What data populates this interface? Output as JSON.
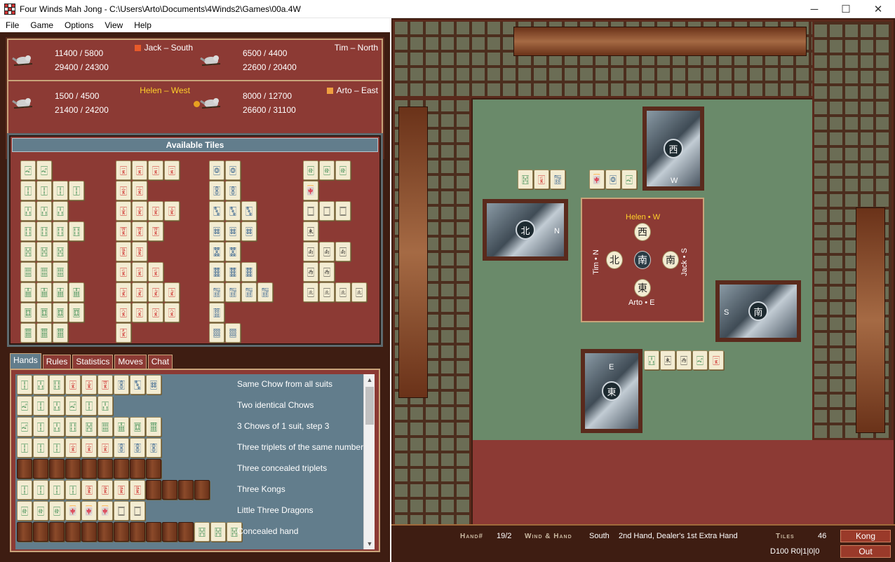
{
  "window": {
    "title": "Four Winds Mah Jong - C:\\Users\\Arto\\Documents\\4Winds2\\Games\\00a.4W",
    "minimize": "─",
    "maximize": "☐",
    "close": "✕"
  },
  "menu": [
    "File",
    "Game",
    "Options",
    "View",
    "Help"
  ],
  "players": [
    {
      "name": "Jack – South",
      "score1": "11400 / 5800",
      "score2": "29400 / 24300",
      "color": "#e85a2a",
      "pos": "tl"
    },
    {
      "name": "Tim – North",
      "score1": "6500 / 4400",
      "score2": "22600 / 20400",
      "color": "",
      "pos": "tr"
    },
    {
      "name": "Helen – West",
      "score1": "1500 / 4500",
      "score2": "21400 / 24200",
      "color": "",
      "pos": "bl"
    },
    {
      "name": "Arto – East",
      "score1": "8000 / 12700",
      "score2": "26600 / 31100",
      "color": "#f0a040",
      "pos": "br"
    }
  ],
  "available": {
    "title": "Available Tiles"
  },
  "tabs": [
    "Hands",
    "Rules",
    "Statistics",
    "Moves",
    "Chat"
  ],
  "hands": [
    {
      "name": "Same Chow from all suits"
    },
    {
      "name": "Two identical Chows"
    },
    {
      "name": "3 Chows of 1 suit, step 3"
    },
    {
      "name": "Three triplets of the same number"
    },
    {
      "name": "Three concealed triplets"
    },
    {
      "name": "Three Kongs"
    },
    {
      "name": "Little Three Dragons"
    },
    {
      "name": "Concealed hand"
    }
  ],
  "table": {
    "helen": "Helen • W",
    "jack": "Jack • S",
    "tim": "Tim • N",
    "arto": "Arto • E",
    "center_wind": "南",
    "w_helen": "西",
    "w_jack": "南",
    "w_tim": "北",
    "w_arto": "東",
    "deck_top": "W",
    "deck_left": "N",
    "deck_right": "S",
    "deck_bottom": "E"
  },
  "status": {
    "hand_label": "Hand#",
    "hand_value": "19/2",
    "wind_label": "Wind & Hand",
    "wind_value": "South",
    "desc": "2nd Hand, Dealer's 1st Extra Hand",
    "tiles_label": "Tiles",
    "tiles_value": "46",
    "code": "D100 R0|1|0|0",
    "btn1": "Kong",
    "btn2": "Out"
  }
}
